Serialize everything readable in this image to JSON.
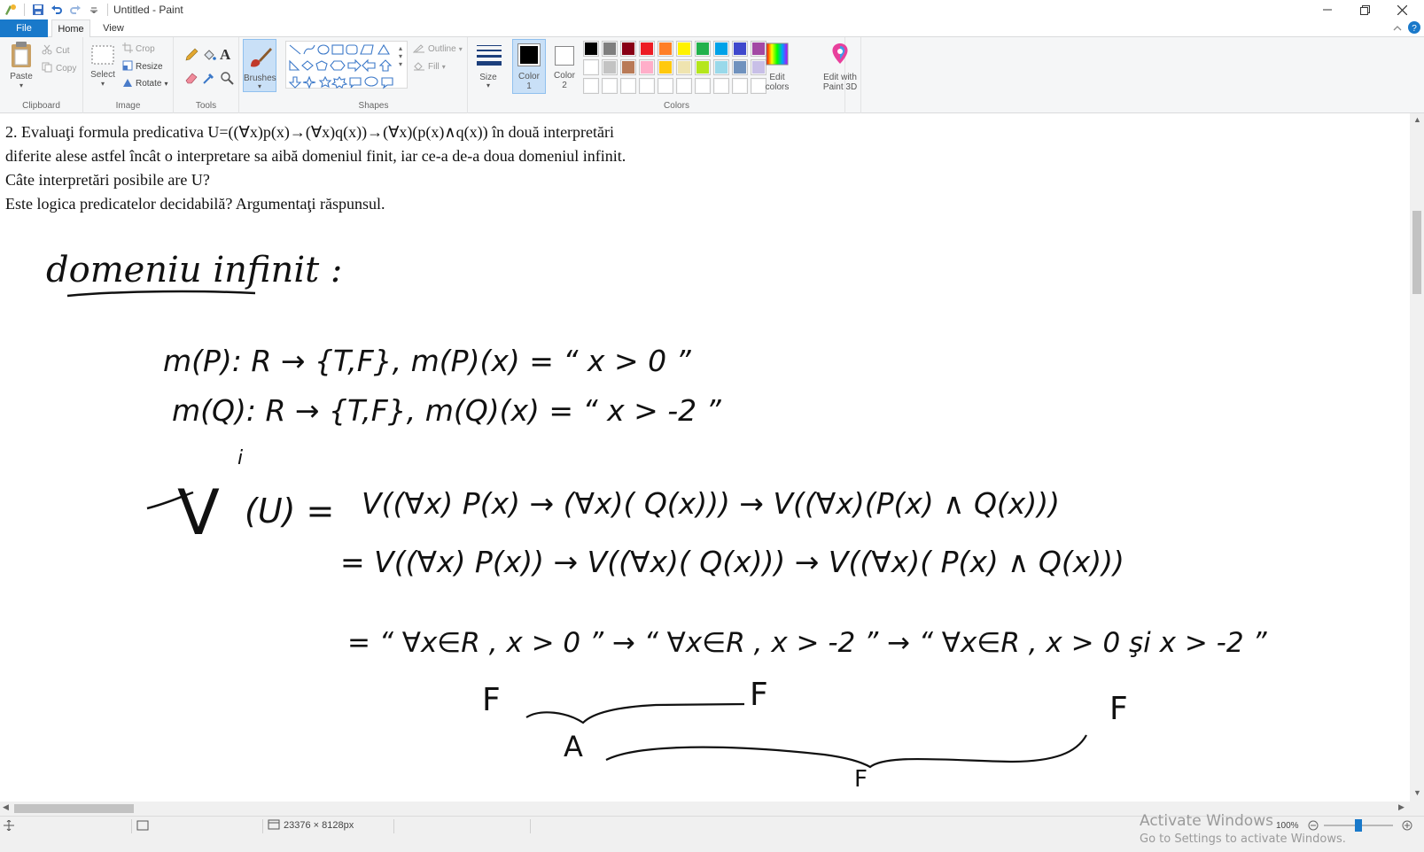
{
  "window": {
    "title": "Untitled - Paint"
  },
  "tabs": {
    "file": "File",
    "home": "Home",
    "view": "View"
  },
  "ribbon": {
    "clipboard": {
      "label": "Clipboard",
      "paste": "Paste",
      "cut": "Cut",
      "copy": "Copy"
    },
    "image": {
      "label": "Image",
      "select": "Select",
      "crop": "Crop",
      "resize": "Resize",
      "rotate": "Rotate"
    },
    "tools": {
      "label": "Tools",
      "text_glyph": "A"
    },
    "brushes": {
      "label": "Brushes"
    },
    "shapes": {
      "label": "Shapes",
      "outline": "Outline",
      "fill": "Fill"
    },
    "size": {
      "label": "Size"
    },
    "colors": {
      "label": "Colors",
      "color1": "Color\n1",
      "color1_l1": "Color",
      "color1_l2": "1",
      "color2_l1": "Color",
      "color2_l2": "2",
      "edit_colors_l1": "Edit",
      "edit_colors_l2": "colors",
      "palette_row1": [
        "#000000",
        "#7f7f7f",
        "#880015",
        "#ed1c24",
        "#ff7f27",
        "#fff200",
        "#22b14c",
        "#00a2e8",
        "#3f48cc",
        "#a349a4"
      ],
      "palette_row2": [
        "#ffffff",
        "#c3c3c3",
        "#b97a57",
        "#ffaec9",
        "#ffc90e",
        "#efe4b0",
        "#b5e61d",
        "#99d9ea",
        "#7092be",
        "#c8bfe7"
      ],
      "color1_value": "#000000",
      "color2_value": "#ffffff"
    },
    "paint3d": {
      "l1": "Edit with",
      "l2": "Paint 3D"
    }
  },
  "canvas": {
    "problem_lines": [
      "2.  Evaluaţi  formula  predicativa  U=((∀x)p(x)→(∀x)q(x))→(∀x)(p(x)∧q(x))   în  două  interpretări",
      "diferite alese astfel încât o interpretare sa aibă domeniul finit, iar ce-a de-a doua domeniul infinit.",
      "Câte interpretări posibile are U?",
      "   Este logica predicatelor decidabilă? Argumentaţi răspunsul."
    ],
    "handwriting": {
      "heading": "domeniu infinit :",
      "line1": "m(P): R → {T,F}, m(P)(x) = “ x > 0 ”",
      "line2": "m(Q): R → {T,F},  m(Q)(x) = “ x > -2 ”",
      "line3_lhs": "V",
      "line3_sup": "i",
      "line3_arg": "(U) =",
      "line3": "V((∀x) P(x) → (∀x)( Q(x))) → V((∀x)(P(x) ∧ Q(x)))",
      "line4": "= V((∀x) P(x)) → V((∀x)( Q(x))) → V((∀x)( P(x) ∧ Q(x)))",
      "line5": "= “ ∀x∈R , x > 0 ” → “ ∀x∈R , x > -2 ” → “ ∀x∈R , x > 0 şi x > -2 ”",
      "v1": "F",
      "v2": "F",
      "v3": "F",
      "brace1": "A",
      "brace2": "F"
    }
  },
  "status": {
    "dimensions": "23376 × 8128px",
    "zoom": "100%",
    "zoom_level": 1.0
  },
  "watermark": {
    "title": "Activate Windows",
    "subtitle": "Go to Settings to activate Windows."
  }
}
